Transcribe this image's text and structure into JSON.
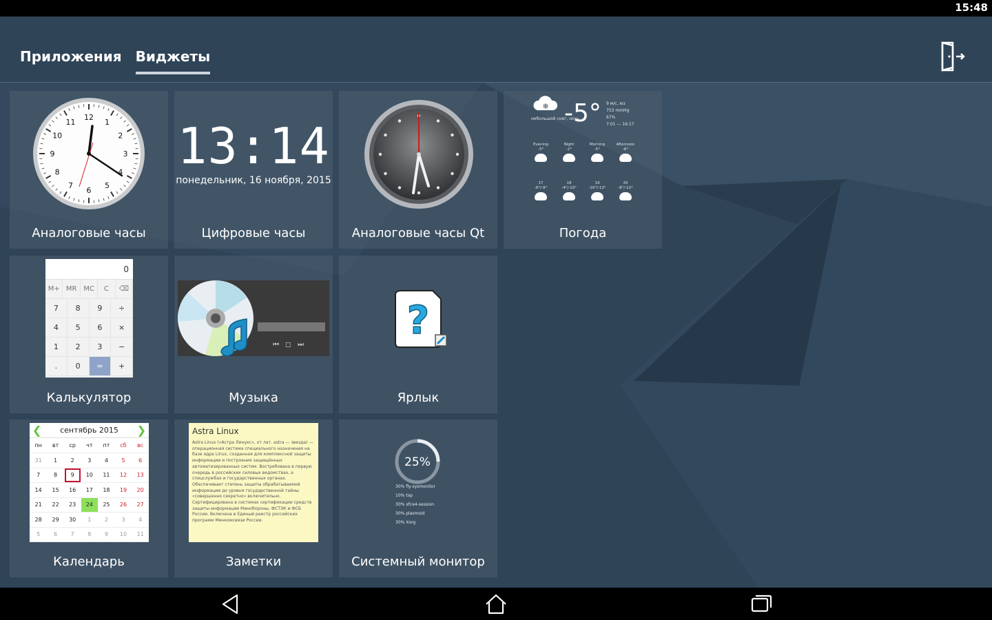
{
  "status_bar": {
    "time": "15:48"
  },
  "tabs": [
    {
      "label": "Приложения"
    },
    {
      "label": "Виджеты"
    }
  ],
  "active_tab": "Виджеты",
  "widgets": [
    {
      "label": "Аналоговые часы"
    },
    {
      "label": "Цифровые часы"
    },
    {
      "label": "Аналоговые часы Qt"
    },
    {
      "label": "Погода"
    },
    {
      "label": "Калькулятор"
    },
    {
      "label": "Музыка"
    },
    {
      "label": "Ярлык"
    },
    {
      "label": "Календарь"
    },
    {
      "label": "Заметки"
    },
    {
      "label": "Системный монитор"
    }
  ],
  "analog_clock": {
    "numbers": [
      "12",
      "1",
      "2",
      "3",
      "4",
      "5",
      "6",
      "7",
      "8",
      "9",
      "10",
      "11"
    ]
  },
  "digital_clock": {
    "time": "13:14",
    "date": "понедельник, 16 ноября, 2015"
  },
  "weather": {
    "temp": "-5°",
    "condition": "небольшой снег, ночь",
    "info": [
      "9 м/с, юз",
      "753 mmHg",
      "67%",
      "7:01 — 16:17"
    ],
    "hours": [
      "Evening",
      "Night",
      "Morning",
      "Afternoon"
    ],
    "hour_temps": [
      "-3°",
      "-2°",
      "-5°",
      "-6°"
    ],
    "days": [
      "17",
      "18",
      "19",
      "20"
    ],
    "day_temps": [
      "-6°/-9°",
      "-4°/-10°",
      "-10°/-13°",
      "-8°/-12°"
    ]
  },
  "calculator": {
    "display": "0",
    "rows": [
      [
        "M+",
        "MR",
        "MC",
        "C",
        "⌫"
      ],
      [
        "7",
        "8",
        "9",
        "÷"
      ],
      [
        "4",
        "5",
        "6",
        "×"
      ],
      [
        "1",
        "2",
        "3",
        "−"
      ],
      [
        ".",
        "0",
        "=",
        "+"
      ]
    ]
  },
  "calendar": {
    "month": "сентябрь 2015",
    "weekdays": [
      "пн",
      "вт",
      "ср",
      "чт",
      "пт",
      "сб",
      "вс"
    ],
    "weeks": [
      [
        "31",
        "1",
        "2",
        "3",
        "4",
        "5",
        "6"
      ],
      [
        "7",
        "8",
        "9",
        "10",
        "11",
        "12",
        "13"
      ],
      [
        "14",
        "15",
        "16",
        "17",
        "18",
        "19",
        "20"
      ],
      [
        "21",
        "22",
        "23",
        "24",
        "25",
        "26",
        "27"
      ],
      [
        "28",
        "29",
        "30",
        "1",
        "2",
        "3",
        "4"
      ],
      [
        "5",
        "6",
        "7",
        "8",
        "9",
        "10",
        "11"
      ]
    ],
    "selected": "9",
    "today": "24"
  },
  "notes": {
    "title": "Astra Linux",
    "body": "Astra Linux («Астра Линукс», от лат. astra — звезда) — операционная система специального назначения на базе ядра Linux, созданная для комплексной защиты информации и построения защищённых автоматизированных систем. Востребована в первую очередь в российских силовых ведомствах, а спецслужбах и государственных органах. Обеспечивает степень защиты обрабатываемой информации до уровня государственной тайны «совершенно секретно» включительно. Сертифицирована в системах сертификации средств защиты информации Минобороны, ФСТЭК и ФСБ России. Включена в Единый реестр российских программ Минкомсвязи России."
  },
  "sysmon": {
    "percent": "25%",
    "level": 0.25,
    "lines": [
      "30% fly-sysmonitor",
      "10% top",
      "30% xfce4-session",
      "30% plasmoid",
      "30% Xorg"
    ]
  },
  "colors": {
    "background": "#2f4457",
    "tile": "#4d5f70",
    "accent_green": "#8ce05a",
    "accent_red": "#c8102e"
  }
}
